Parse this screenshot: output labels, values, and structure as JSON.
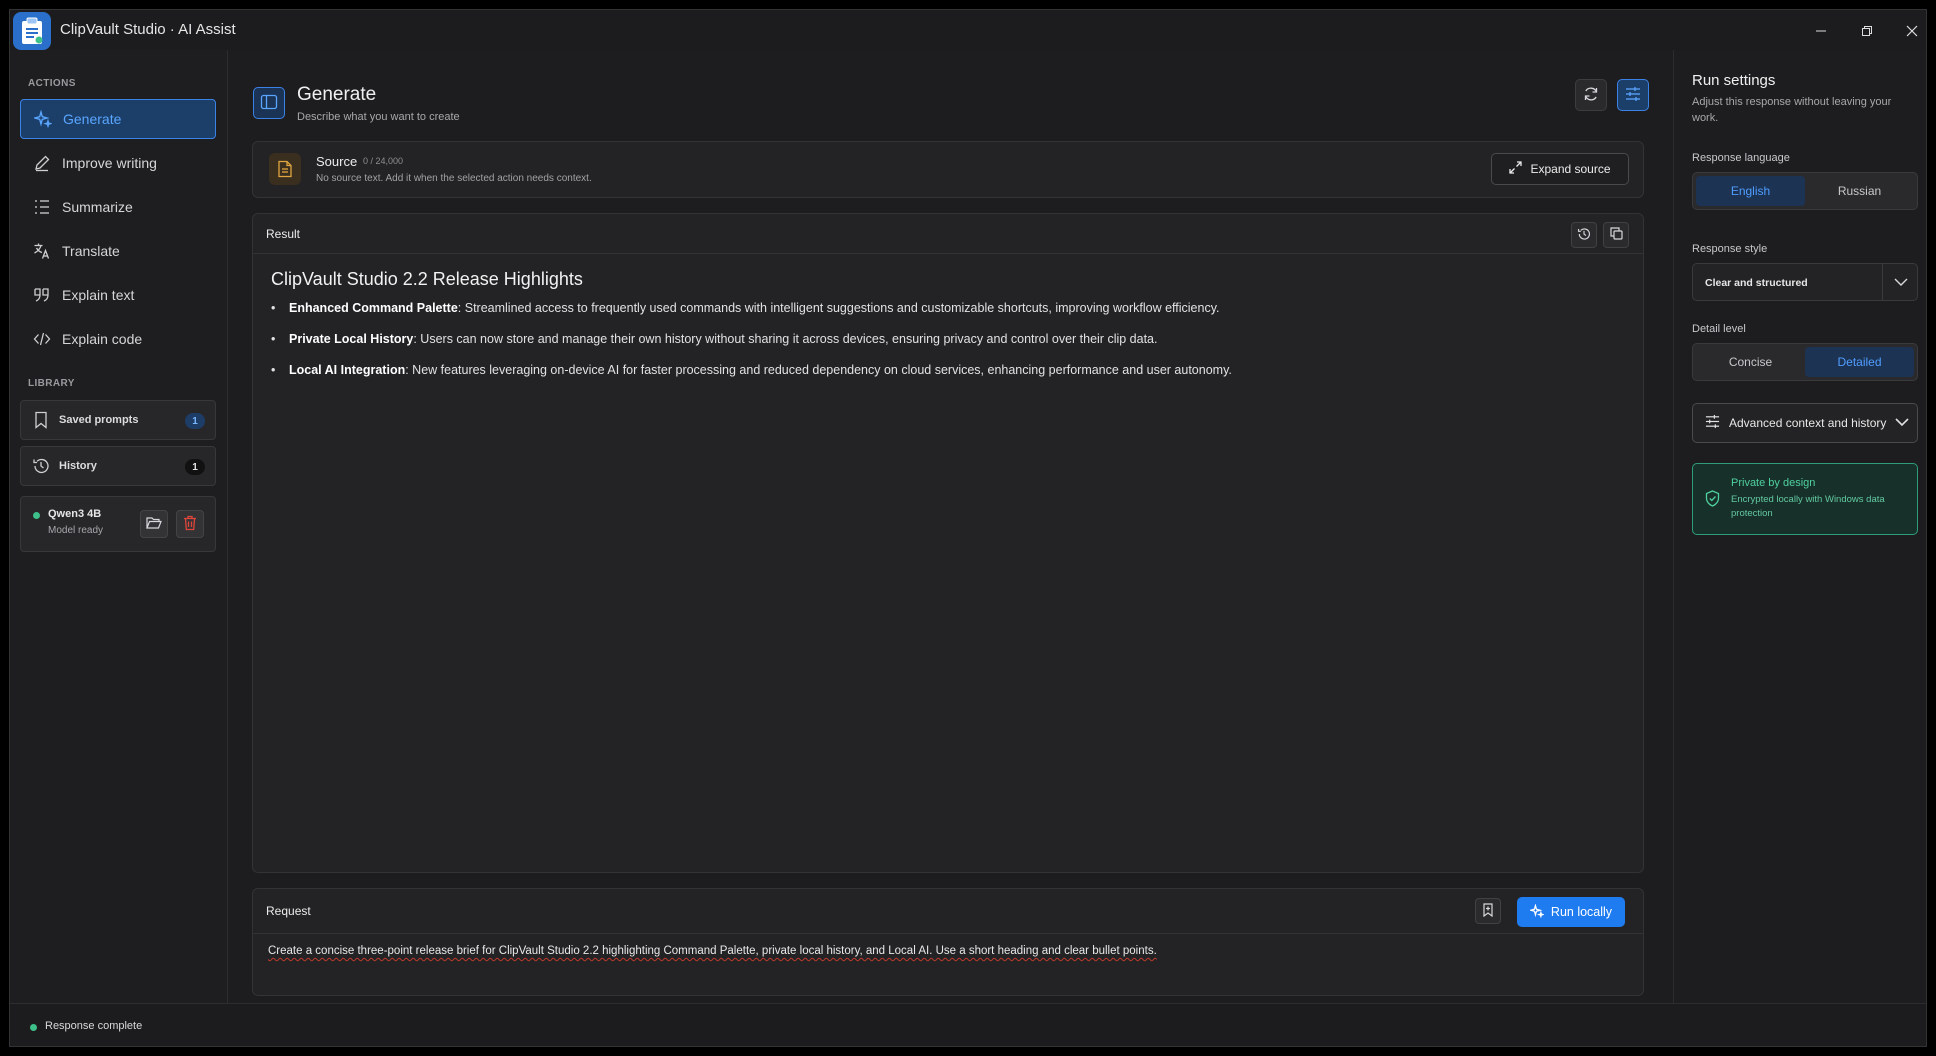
{
  "app": {
    "title": "ClipVault Studio · AI Assist"
  },
  "sidebar": {
    "actions_label": "ACTIONS",
    "items": [
      {
        "label": "Generate",
        "icon": "sparkles-icon",
        "active": true
      },
      {
        "label": "Improve writing",
        "icon": "pencil-icon"
      },
      {
        "label": "Summarize",
        "icon": "list-icon"
      },
      {
        "label": "Translate",
        "icon": "translate-icon"
      },
      {
        "label": "Explain text",
        "icon": "quote-icon"
      },
      {
        "label": "Explain code",
        "icon": "code-icon"
      }
    ],
    "library_label": "LIBRARY",
    "library": [
      {
        "label": "Saved prompts",
        "count": "1",
        "icon": "bookmark-icon"
      },
      {
        "label": "History",
        "count": "1",
        "icon": "history-icon"
      }
    ],
    "model": {
      "name": "Qwen3 4B",
      "status": "Model ready"
    }
  },
  "header": {
    "title": "Generate",
    "subtitle": "Describe what you want to create"
  },
  "source": {
    "title": "Source",
    "count": "0 / 24,000",
    "hint": "No source text. Add it when the selected action needs context.",
    "expand_label": "Expand source"
  },
  "result": {
    "label": "Result",
    "heading": "ClipVault Studio 2.2 Release Highlights",
    "bullets": [
      {
        "term": "Enhanced Command Palette",
        "text": ": Streamlined access to frequently used commands with intelligent suggestions and customizable shortcuts, improving workflow efficiency."
      },
      {
        "term": "Private Local History",
        "text": ": Users can now store and manage their own history without sharing it across devices, ensuring privacy and control over their clip data."
      },
      {
        "term": "Local AI Integration",
        "text": ": New features leveraging on-device AI for faster processing and reduced dependency on cloud services, enhancing performance and user autonomy."
      }
    ]
  },
  "request": {
    "label": "Request",
    "run_label": "Run locally",
    "text": "Create a concise three-point release brief for ClipVault Studio 2.2 highlighting Command Palette, private local history, and Local AI. Use a short heading and clear bullet points."
  },
  "settings": {
    "title": "Run settings",
    "subtitle": "Adjust this response without leaving your work.",
    "language_label": "Response language",
    "languages": [
      "English",
      "Russian"
    ],
    "language_selected": "English",
    "style_label": "Response style",
    "style_value": "Clear and structured",
    "detail_label": "Detail level",
    "details": [
      "Concise",
      "Detailed"
    ],
    "detail_selected": "Detailed",
    "advanced_label": "Advanced context and history",
    "private_title": "Private by design",
    "private_sub": "Encrypted locally with Windows data protection"
  },
  "status": {
    "text": "Response complete"
  },
  "colors": {
    "accent": "#1e7cf0",
    "success": "#3ec08a",
    "private": "#2f9d7a"
  }
}
